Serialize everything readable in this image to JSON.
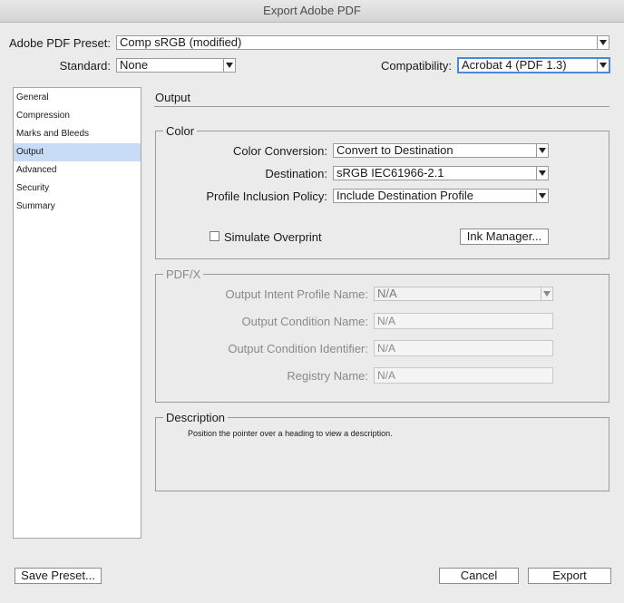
{
  "window": {
    "title": "Export Adobe PDF"
  },
  "top": {
    "preset_label": "Adobe PDF Preset:",
    "preset_value": "Comp sRGB (modified)",
    "standard_label": "Standard:",
    "standard_value": "None",
    "compat_label": "Compatibility:",
    "compat_value": "Acrobat 4 (PDF 1.3)"
  },
  "sidebar": {
    "items": [
      {
        "label": "General"
      },
      {
        "label": "Compression"
      },
      {
        "label": "Marks and Bleeds"
      },
      {
        "label": "Output",
        "selected": true
      },
      {
        "label": "Advanced"
      },
      {
        "label": "Security"
      },
      {
        "label": "Summary"
      }
    ]
  },
  "main": {
    "heading": "Output",
    "color_group": {
      "title": "Color",
      "conversion_label": "Color Conversion:",
      "conversion_value": "Convert to Destination",
      "destination_label": "Destination:",
      "destination_value": "sRGB IEC61966-2.1",
      "profile_label": "Profile Inclusion Policy:",
      "profile_value": "Include Destination Profile",
      "simulate_label": "Simulate Overprint",
      "simulate_checked": false,
      "ink_manager_label": "Ink Manager..."
    },
    "pdfx_group": {
      "title": "PDF/X",
      "intent_label": "Output Intent Profile Name:",
      "intent_value": "N/A",
      "cond_name_label": "Output Condition Name:",
      "cond_name_value": "N/A",
      "cond_id_label": "Output Condition Identifier:",
      "cond_id_value": "N/A",
      "registry_label": "Registry Name:",
      "registry_value": "N/A"
    },
    "description_group": {
      "title": "Description",
      "text": "Position the pointer over a heading to view a description."
    }
  },
  "footer": {
    "save_preset_label": "Save Preset...",
    "cancel_label": "Cancel",
    "export_label": "Export"
  },
  "colors": {
    "background": "#ebebeb",
    "selection": "#c8dcf5",
    "focus": "#4a89dc"
  }
}
